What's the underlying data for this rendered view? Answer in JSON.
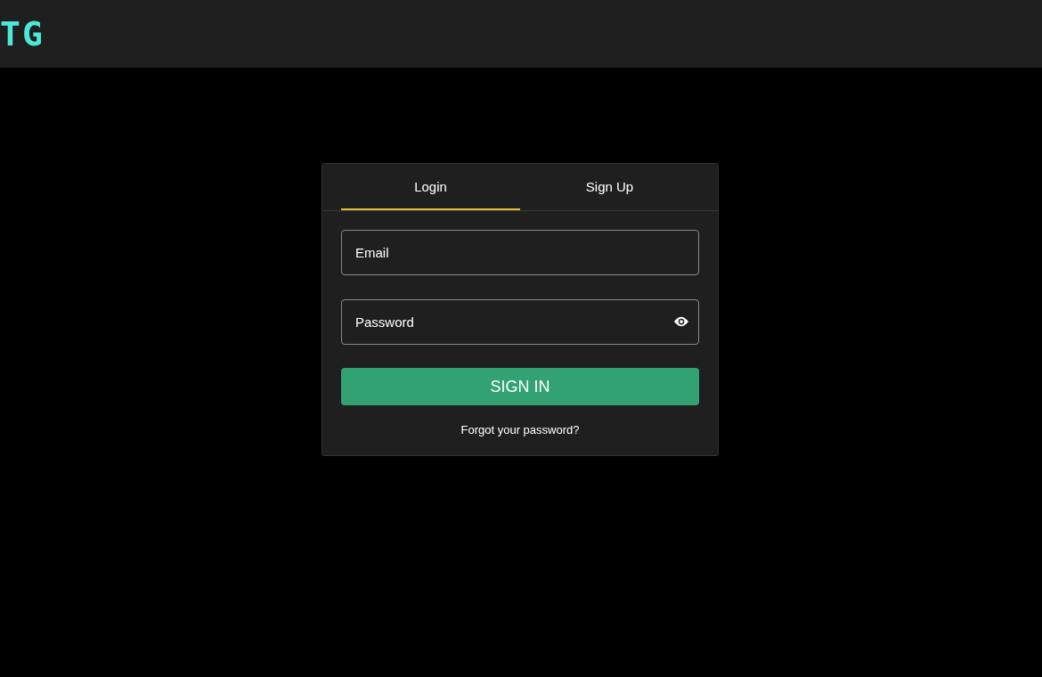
{
  "header": {
    "logo": "TG"
  },
  "tabs": [
    {
      "label": "Login",
      "selected": true
    },
    {
      "label": "Sign Up",
      "selected": false
    }
  ],
  "fields": [
    {
      "kind": "email",
      "placeholder": "Email"
    },
    {
      "kind": "password",
      "placeholder": "Password"
    }
  ],
  "submit_button": "SIGN IN",
  "forgot_link": "Forgot your password?"
}
